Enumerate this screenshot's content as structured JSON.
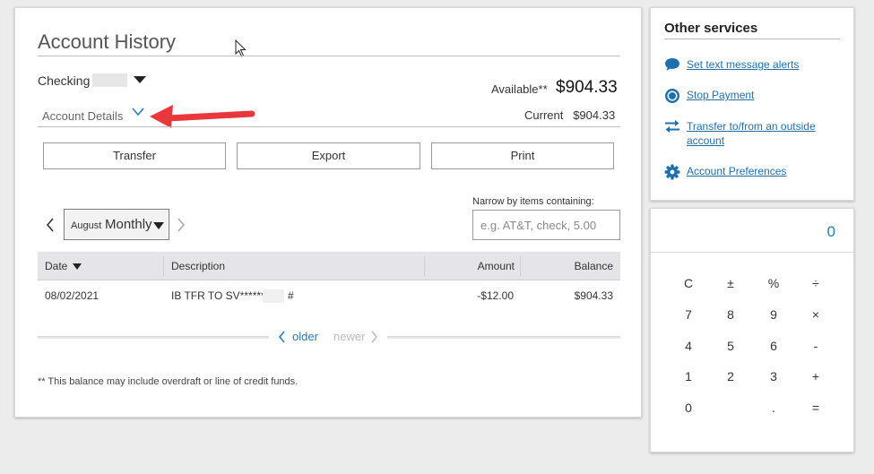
{
  "account_history": {
    "title": "Account History",
    "account_selector": {
      "label": "Checking"
    },
    "available": {
      "label": "Available**",
      "value": "$904.33"
    },
    "account_details_label": "Account Details",
    "current": {
      "label": "Current",
      "value": "$904.33"
    },
    "buttons": {
      "transfer": "Transfer",
      "export": "Export",
      "print": "Print"
    },
    "filter": {
      "label": "Narrow by items containing:",
      "placeholder": "e.g. AT&T, check, 5.00",
      "value": ""
    },
    "period": {
      "month": "August",
      "frequency": "Monthly"
    },
    "table": {
      "headers": {
        "date": "Date",
        "description": "Description",
        "amount": "Amount",
        "balance": "Balance"
      },
      "rows": [
        {
          "date": "08/02/2021",
          "description": "IB TFR TO SV******",
          "suffix": "#",
          "amount": "-$12.00",
          "balance": "$904.33"
        }
      ]
    },
    "pager": {
      "older": "older",
      "newer": "newer"
    },
    "footnote": "** This balance may include overdraft or line of credit funds."
  },
  "other_services": {
    "title": "Other services",
    "items": [
      {
        "label": "Set text message alerts",
        "icon": "chat-bubble-icon"
      },
      {
        "label": "Stop Payment",
        "icon": "stop-circle-icon"
      },
      {
        "label": "Transfer to/from an outside account",
        "icon": "transfer-arrows-icon"
      },
      {
        "label": "Account Preferences",
        "icon": "gear-icon"
      }
    ]
  },
  "calculator": {
    "display": "0",
    "keys": [
      [
        "C",
        "±",
        "%",
        "÷"
      ],
      [
        "7",
        "8",
        "9",
        "×"
      ],
      [
        "4",
        "5",
        "6",
        "-"
      ],
      [
        "1",
        "2",
        "3",
        "+"
      ],
      [
        "0",
        "",
        ".",
        "="
      ]
    ]
  },
  "colors": {
    "link": "#1f6fae",
    "accent": "#2a7ab8",
    "annotation_arrow": "#e8383d"
  }
}
